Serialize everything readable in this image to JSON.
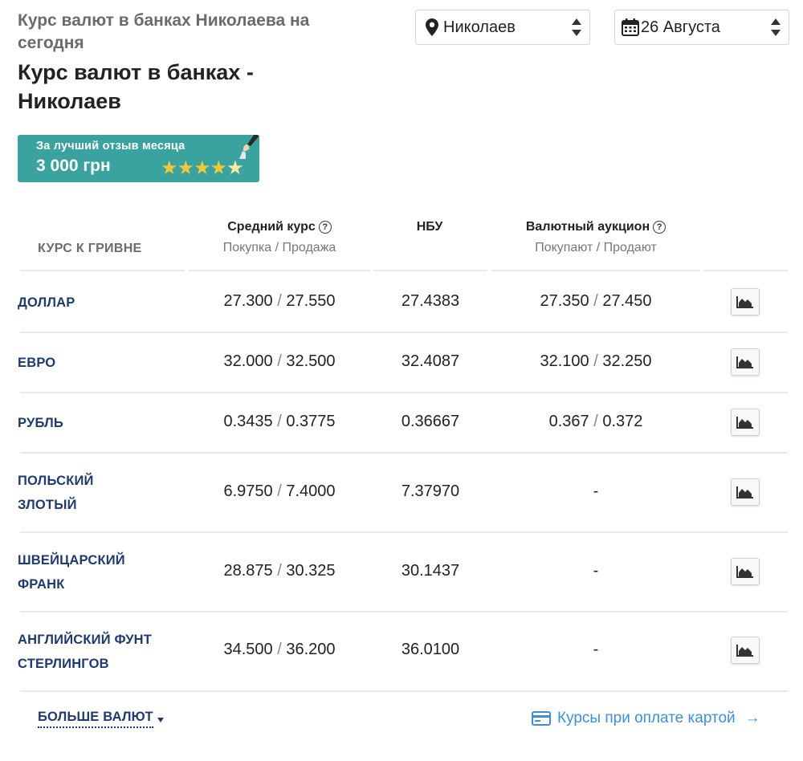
{
  "header": {
    "subtitle": "Курс валют в банках Николаева на сегодня",
    "title": "Курс валют в банках - Николаев"
  },
  "city_select": {
    "value": "Николаев"
  },
  "date_select": {
    "value": "26 Августа"
  },
  "banner": {
    "line1": "За лучший отзыв месяца",
    "amount": "3 000 грн",
    "stars": "★★★★",
    "last_star": "★"
  },
  "table": {
    "col_label": "КУРС К ГРИВНЕ",
    "col_avg": "Средний курс",
    "col_avg_sub": "Покупка / Продажа",
    "col_nbu": "НБУ",
    "col_auction": "Валютный аукцион",
    "col_auction_sub": "Покупают / Продают",
    "help_glyph": "?",
    "slash": "/",
    "rows": [
      {
        "name": "ДОЛЛАР",
        "buy": "27.300",
        "sell": "27.550",
        "nbu": "27.4383",
        "auc_buy": "27.350",
        "auc_sell": "27.450",
        "auc_dash": ""
      },
      {
        "name": "ЕВРО",
        "buy": "32.000",
        "sell": "32.500",
        "nbu": "32.4087",
        "auc_buy": "32.100",
        "auc_sell": "32.250",
        "auc_dash": ""
      },
      {
        "name": "РУБЛЬ",
        "buy": "0.3435",
        "sell": "0.3775",
        "nbu": "0.36667",
        "auc_buy": "0.367",
        "auc_sell": "0.372",
        "auc_dash": ""
      },
      {
        "name1": "ПОЛЬСКИЙ",
        "name2": "ЗЛОТЫЙ",
        "buy": "6.9750",
        "sell": "7.4000",
        "nbu": "7.37970",
        "auc_dash": "-"
      },
      {
        "name1": "ШВЕЙЦАРСКИЙ",
        "name2": "ФРАНК",
        "buy": "28.875",
        "sell": "30.325",
        "nbu": "30.1437",
        "auc_dash": "-"
      },
      {
        "name1": "АНГЛИЙСКИЙ ФУНТ",
        "name2": "СТЕРЛИНГОВ",
        "buy": "34.500",
        "sell": "36.200",
        "nbu": "36.0100",
        "auc_dash": "-"
      }
    ]
  },
  "footer": {
    "more_label": "БОЛЬШЕ ВАЛЮТ",
    "card_label": "Курсы при оплате картой",
    "card_arrow": "→"
  },
  "icons": {
    "location": "map-pin-icon",
    "calendar": "calendar-icon",
    "chart": "area-chart-icon",
    "card": "credit-card-icon"
  },
  "colors": {
    "banner": "#3aa3a0",
    "currency_text": "#1f3b6e",
    "link": "#3f8fd8",
    "stars": "#f3c63b"
  }
}
